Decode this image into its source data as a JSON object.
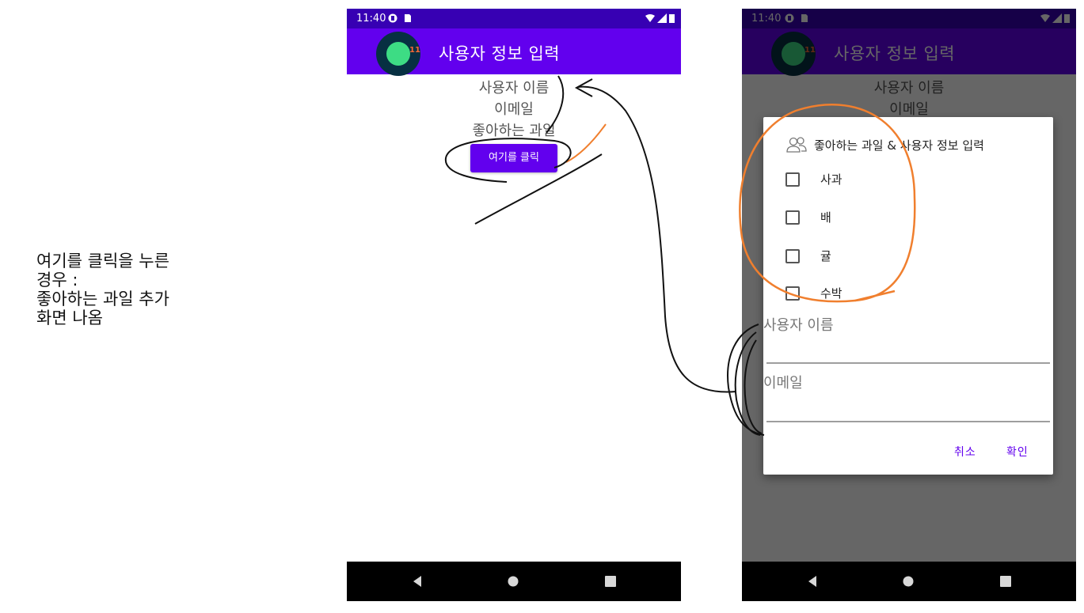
{
  "annotation": {
    "lines": [
      "여기를 클릭을 누른",
      "경우 :",
      "좋아하는 과일 추가",
      "화면 나옴"
    ]
  },
  "status_bar": {
    "time": "11:40"
  },
  "app_bar": {
    "title": "사용자 정보 입력",
    "logo_text": "11"
  },
  "main_screen": {
    "username_label": "사용자 이름",
    "email_label": "이메일",
    "favorite_fruit_label": "좋아하는 과일",
    "click_button": "여기를 클릭"
  },
  "dialog": {
    "title": "좋아하는 과일 & 사용자 정보 입력",
    "title_icon": "people-icon",
    "options": [
      {
        "label": "사과",
        "checked": false
      },
      {
        "label": "배",
        "checked": false
      },
      {
        "label": "귤",
        "checked": false
      },
      {
        "label": "수박",
        "checked": false
      }
    ],
    "username_field_hint": "사용자 이름",
    "email_field_hint": "이메일",
    "cancel_button": "취소",
    "confirm_button": "확인"
  },
  "colors": {
    "primary": "#6200ee",
    "primary_dark": "#3700b3",
    "annotation_orange": "#f07f2e",
    "annotation_black": "#111111"
  },
  "nav_icons": [
    "back-icon",
    "home-icon",
    "recents-icon"
  ]
}
